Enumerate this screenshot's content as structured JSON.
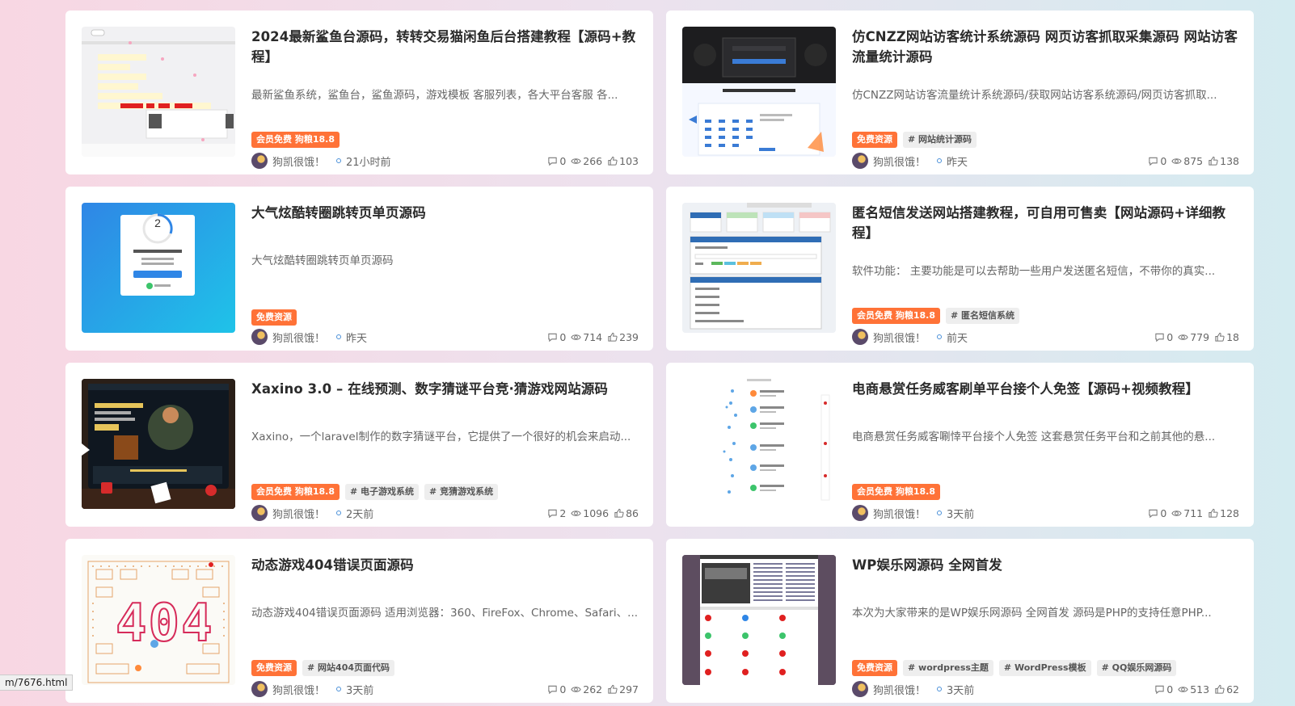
{
  "cards": [
    {
      "title": "2024最新鲨鱼台源码，转转交易猫闲鱼后台搭建教程【源码+教程】",
      "excerpt": "最新鲨鱼系统，鲨鱼台，鲨鱼源码，游戏模板 客服列表，各大平台客服 各...",
      "tags": [
        "会员免费 狗粮18.8"
      ],
      "author": "狗凯很饿！",
      "time": "21小时前",
      "comments": "0",
      "views": "266",
      "likes": "103"
    },
    {
      "title": "仿CNZZ网站访客统计系统源码 网页访客抓取采集源码 网站访客流量统计源码",
      "excerpt": "仿CNZZ网站访客流量统计系统源码/获取网站访客系统源码/网页访客抓取...",
      "tags": [
        "免费资源",
        "# 网站统计源码"
      ],
      "author": "狗凯很饿！",
      "time": "昨天",
      "comments": "0",
      "views": "875",
      "likes": "138"
    },
    {
      "title": "大气炫酷转圈跳转页单页源码",
      "excerpt": "大气炫酷转圈跳转页单页源码",
      "tags": [
        "免费资源"
      ],
      "author": "狗凯很饿！",
      "time": "昨天",
      "comments": "0",
      "views": "714",
      "likes": "239",
      "thumb_counter": "2"
    },
    {
      "title": "匿名短信发送网站搭建教程，可自用可售卖【网站源码+详细教程】",
      "excerpt": "软件功能： 主要功能是可以去帮助一些用户发送匿名短信，不带你的真实...",
      "tags": [
        "会员免费 狗粮18.8",
        "# 匿名短信系统"
      ],
      "author": "狗凯很饿！",
      "time": "前天",
      "comments": "0",
      "views": "779",
      "likes": "18"
    },
    {
      "title": "Xaxino 3.0 – 在线预测、数字猜谜平台竞·猜游戏网站源码",
      "excerpt": "Xaxino，一个laravel制作的数字猜谜平台，它提供了一个很好的机会来启动...",
      "tags": [
        "会员免费 狗粮18.8",
        "# 电子游戏系统",
        "# 竞猜游戏系统"
      ],
      "author": "狗凯很饿！",
      "time": "2天前",
      "comments": "2",
      "views": "1096",
      "likes": "86"
    },
    {
      "title": "电商悬赏任务威客刷单平台接个人免签【源码+视频教程】",
      "excerpt": "电商悬赏任务威客唰悻平台接个人免签 这套悬赏任务平台和之前其他的悬...",
      "tags": [
        "会员免费 狗粮18.8"
      ],
      "author": "狗凯很饿！",
      "time": "3天前",
      "comments": "0",
      "views": "711",
      "likes": "128"
    },
    {
      "title": "动态游戏404错误页面源码",
      "excerpt": "动态游戏404错误页面源码 适用浏览器：360、FireFox、Chrome、Safari、...",
      "tags": [
        "免费资源",
        "# 网站404页面代码"
      ],
      "author": "狗凯很饿！",
      "time": "3天前",
      "comments": "0",
      "views": "262",
      "likes": "297",
      "thumb_text": "404"
    },
    {
      "title": "WP娱乐网源码 全网首发",
      "excerpt": "本次为大家带来的是WP娱乐网源码 全网首发 源码是PHP的支持任意PHP...",
      "tags": [
        "免费资源",
        "# wordpress主题",
        "# WordPress模板",
        "# QQ娱乐网源码"
      ],
      "author": "狗凯很饿！",
      "time": "3天前",
      "comments": "0",
      "views": "513",
      "likes": "62"
    }
  ],
  "status_bar": {
    "url": "m/7676.html"
  },
  "colors": {
    "accent_tag": "#ff7237",
    "time_dot": "#4a90d9"
  }
}
